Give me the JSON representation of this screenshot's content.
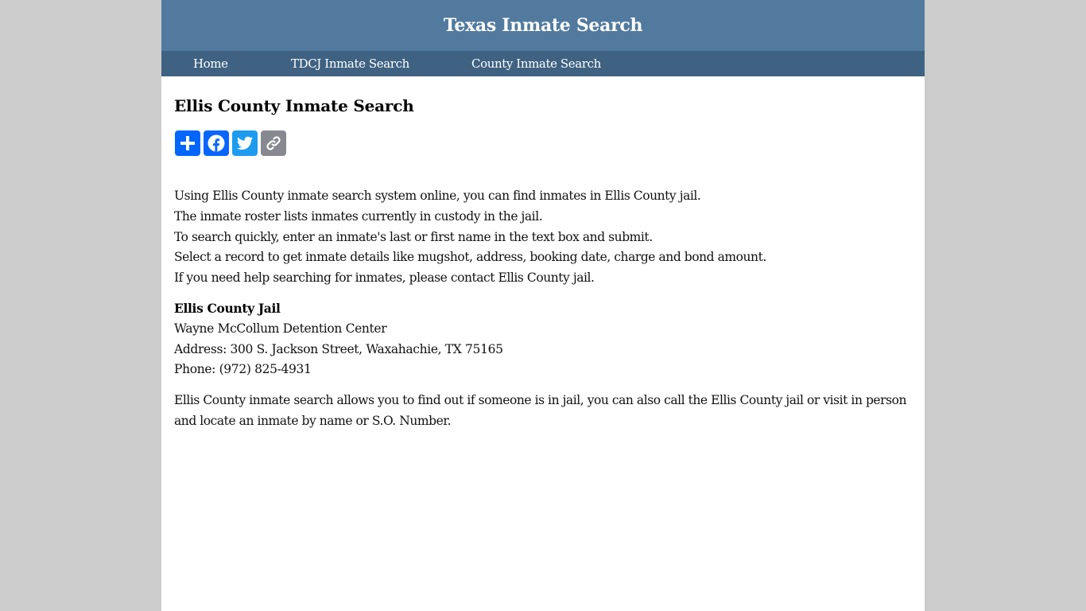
{
  "header": {
    "title": "Texas Inmate Search"
  },
  "nav": {
    "items": [
      {
        "label": "Home"
      },
      {
        "label": "TDCJ Inmate Search"
      },
      {
        "label": "County Inmate Search"
      }
    ]
  },
  "main": {
    "heading": "Ellis County Inmate Search",
    "share_buttons": [
      {
        "name": "share",
        "icon": "plus-icon",
        "color": "#0166ff"
      },
      {
        "name": "facebook",
        "icon": "facebook-icon",
        "color": "#0866ff"
      },
      {
        "name": "twitter",
        "icon": "twitter-icon",
        "color": "#1d9bf0"
      },
      {
        "name": "copy-link",
        "icon": "link-icon",
        "color": "#888990"
      }
    ],
    "intro_lines": [
      "Using Ellis County inmate search system online, you can find inmates in Ellis County jail.",
      "The inmate roster lists inmates currently in custody in the jail.",
      "To search quickly, enter an inmate's last or first name in the text box and submit.",
      "Select a record to get inmate details like mugshot, address, booking date, charge and bond amount.",
      "If you need help searching for inmates, please contact Ellis County jail."
    ],
    "jail": {
      "name": "Ellis County Jail",
      "facility": "Wayne McCollum Detention Center",
      "address": "Address: 300 S. Jackson Street, Waxahachie, TX 75165",
      "phone": "Phone: (972) 825-4931"
    },
    "closing": "Ellis County inmate search allows you to find out if someone is in jail, you can also call the Ellis County jail or visit in person and locate an inmate by name or S.O. Number."
  },
  "colors": {
    "header_bg": "#527a9e",
    "nav_bg": "#3f6282",
    "page_bg": "#cccccc"
  }
}
